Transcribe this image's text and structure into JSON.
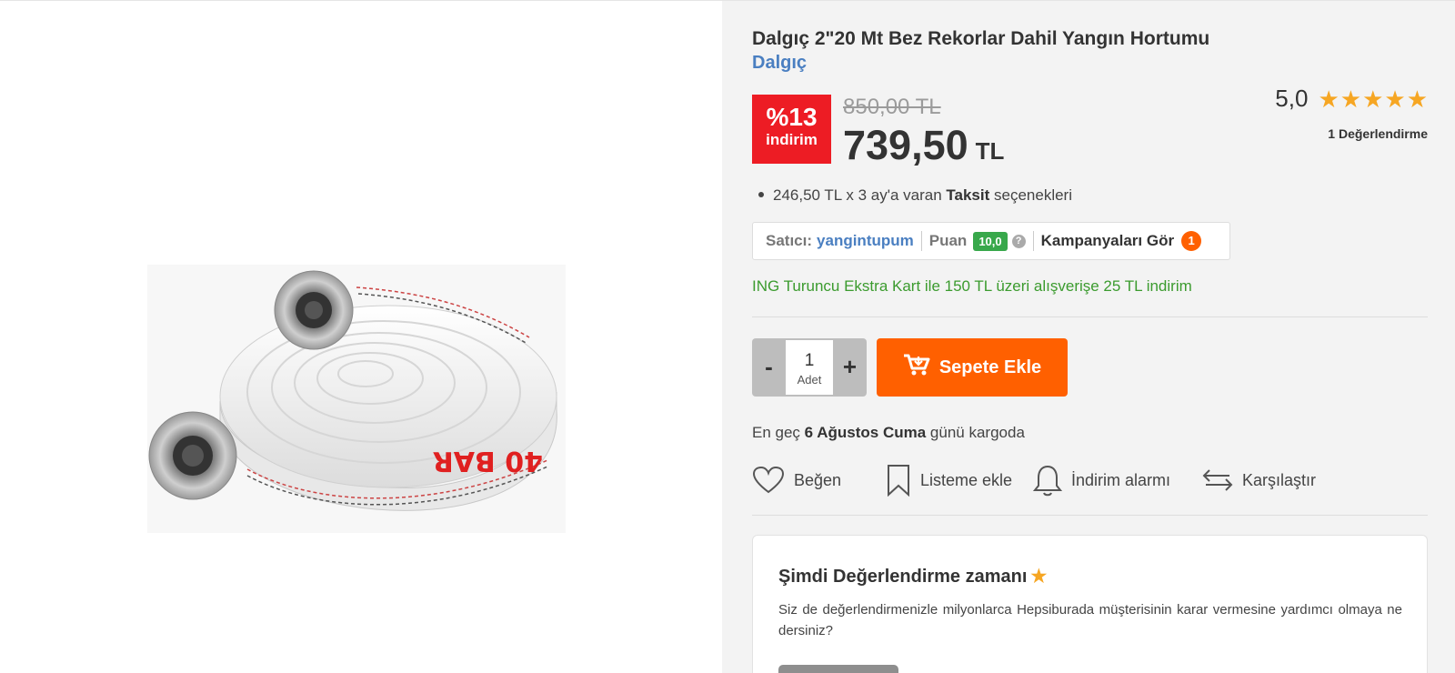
{
  "product": {
    "title": "Dalgıç 2\"20 Mt Bez Rekorlar Dahil Yangın Hortumu",
    "brand": "Dalgıç",
    "image_label": "40 BAR"
  },
  "pricing": {
    "discount_percent": "%13",
    "discount_label": "indirim",
    "old_price": "850,00 TL",
    "new_price": "739,50",
    "currency": "TL"
  },
  "rating": {
    "score": "5,0",
    "stars": 5,
    "count_label": "1 Değerlendirme"
  },
  "installment": {
    "prefix": "246,50 TL x 3 ay'a varan",
    "bold": "Taksit",
    "suffix": "seçenekleri"
  },
  "seller": {
    "label": "Satıcı:",
    "name": "yangintupum",
    "score_label": "Puan",
    "score": "10,0",
    "help": "?",
    "campaigns_label": "Kampanyaları Gör",
    "campaigns_count": "1"
  },
  "promo": "ING Turuncu Ekstra Kart ile 150 TL üzeri alışverişe 25 TL indirim",
  "quantity": {
    "minus": "-",
    "value": "1",
    "unit": "Adet",
    "plus": "+"
  },
  "cart": {
    "add_label": "Sepete Ekle"
  },
  "delivery": {
    "prefix": "En geç",
    "date": "6 Ağustos Cuma",
    "suffix": "günü kargoda"
  },
  "actions": {
    "like": "Beğen",
    "list": "Listeme ekle",
    "alarm": "İndirim alarmı",
    "compare": "Karşılaştır"
  },
  "review_prompt": {
    "title": "Şimdi Değerlendirme zamanı",
    "description": "Siz de değerlendirmenizle milyonlarca Hepsiburada müşterisinin karar vermesine yardımcı olmaya ne dersiniz?"
  },
  "colors": {
    "accent": "#ff6000",
    "discount": "#ed1c24",
    "brand_link": "#4a7fc1",
    "promo_green": "#3b9b2e",
    "star": "#f6a623",
    "right_bg": "#f3f3f3"
  }
}
